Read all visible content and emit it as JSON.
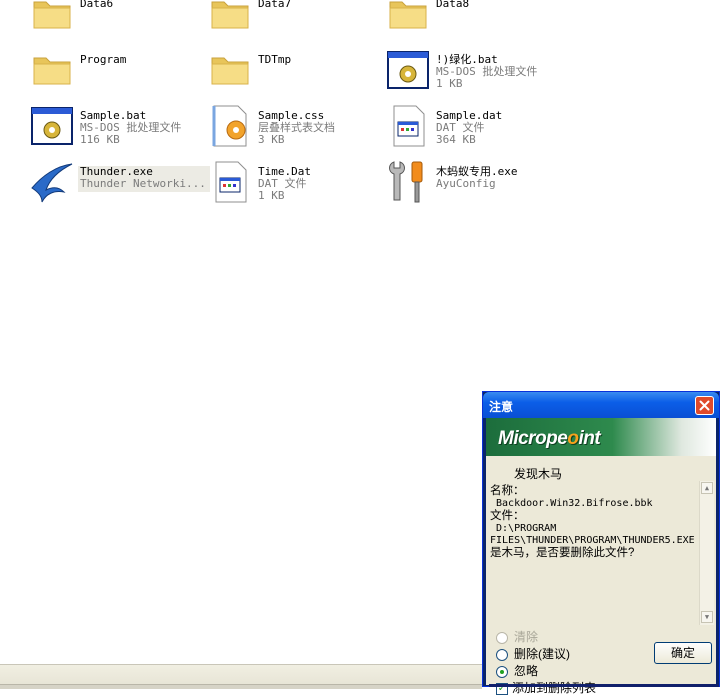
{
  "files": [
    {
      "name": "Data6",
      "icon": "folder",
      "l2": "",
      "l3": "",
      "row": 0,
      "col": 0
    },
    {
      "name": "Data7",
      "icon": "folder",
      "l2": "",
      "l3": "",
      "row": 0,
      "col": 1
    },
    {
      "name": "Data8",
      "icon": "folder",
      "l2": "",
      "l3": "",
      "row": 0,
      "col": 2
    },
    {
      "name": "Program",
      "icon": "folder",
      "l2": "",
      "l3": "",
      "row": 1,
      "col": 0
    },
    {
      "name": "TDTmp",
      "icon": "folder",
      "l2": "",
      "l3": "",
      "row": 1,
      "col": 1
    },
    {
      "name": "!)绿化.bat",
      "icon": "batch",
      "l2": "MS-DOS 批处理文件",
      "l3": "1 KB",
      "row": 1,
      "col": 2
    },
    {
      "name": "Sample.bat",
      "icon": "batch",
      "l2": "MS-DOS 批处理文件",
      "l3": "116 KB",
      "row": 2,
      "col": 0
    },
    {
      "name": "Sample.css",
      "icon": "css",
      "l2": "层叠样式表文档",
      "l3": "3 KB",
      "row": 2,
      "col": 1
    },
    {
      "name": "Sample.dat",
      "icon": "dat",
      "l2": "DAT 文件",
      "l3": "364 KB",
      "row": 2,
      "col": 2
    },
    {
      "name": "Thunder.exe",
      "icon": "thunder",
      "l2": "Thunder Networki...",
      "l3": "",
      "row": 3,
      "col": 0,
      "selected": true
    },
    {
      "name": "Time.Dat",
      "icon": "dat",
      "l2": "DAT 文件",
      "l3": "1 KB",
      "row": 3,
      "col": 1
    },
    {
      "name": "木蚂蚁专用.exe",
      "icon": "tools",
      "l2": "AyuConfig",
      "l3": "",
      "row": 3,
      "col": 2
    }
  ],
  "dialog": {
    "title": "注意",
    "logo_prefix": "Micrope",
    "logo_o": "o",
    "logo_suffix": "int",
    "found_text": "发现木马",
    "msg_name_label": "名称：",
    "msg_name_value": " Backdoor.Win32.Bifrose.bbk",
    "msg_file_label": "文件：",
    "msg_file_value1": " D:\\PROGRAM",
    "msg_file_value2": "FILES\\THUNDER\\PROGRAM\\THUNDER5.EXE",
    "msg_question": "是木马，是否要删除此文件?",
    "options": [
      {
        "label": "清除",
        "checked": false,
        "disabled": true
      },
      {
        "label": "删除(建议)",
        "checked": false,
        "disabled": false
      },
      {
        "label": "忽略",
        "checked": true,
        "disabled": false
      }
    ],
    "add_to_list_label": "添加到删除列表",
    "add_to_list_checked": true,
    "ok_label": "确定",
    "colors": {
      "title_bar": "#0b5ee8",
      "close": "#e04a2b",
      "banner": "#2e8a4d"
    }
  }
}
